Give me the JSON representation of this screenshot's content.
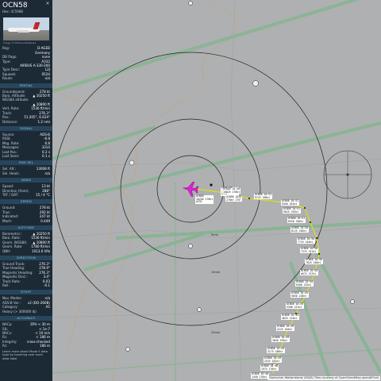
{
  "flight": {
    "callsign": "OCN58",
    "hex_label": "Hex:",
    "hex": "3C5988",
    "photo_credit": "Image © Michael Rodeback"
  },
  "aircraft_info": [
    {
      "k": "Reg:",
      "v": "D-AGEB"
    },
    {
      "k": "",
      "v": "Germany"
    },
    {
      "k": "DB flags:",
      "v": "none"
    },
    {
      "k": "Type:",
      "v": "A332"
    },
    {
      "k": "",
      "v": "AIRBUS A-330-200"
    },
    {
      "k": "Type Desc:",
      "v": "L2J"
    },
    {
      "k": "Squawk:",
      "v": "0524"
    },
    {
      "k": "Route:",
      "v": "n/a"
    }
  ],
  "sections": [
    {
      "title": "SPATIAL",
      "rows": [
        {
          "k": "Groundspeed:",
          "v": "278 kt"
        },
        {
          "k": "Baro. Altitude:",
          "v": "▲ 10250 ft"
        },
        {
          "k": "WGS84 altitude:",
          "v": ""
        },
        {
          "k": "",
          "v": "▲ 10800 ft"
        },
        {
          "k": "Vert. Rate:",
          "v": "1536 ft/min"
        },
        {
          "k": "Track:",
          "v": "276.3°"
        },
        {
          "k": "Pos.:",
          "v": "51.205°, 6.624°"
        },
        {
          "k": "Distance:",
          "v": "1.2 nmi"
        }
      ]
    },
    {
      "title": "SIGNAL",
      "rows": [
        {
          "k": "Source:",
          "v": "ADS-B"
        },
        {
          "k": "RSSI:",
          "v": "-6.8"
        },
        {
          "k": "Msg. Rate:",
          "v": "6.8"
        },
        {
          "k": "Messages:",
          "v": "3314"
        },
        {
          "k": "Last Pos.:",
          "v": "0.2 s"
        },
        {
          "k": "Last Seen:",
          "v": "0.1 s"
        }
      ]
    },
    {
      "title": "FMS SEL",
      "rows": [
        {
          "k": "Sel. Alt.:",
          "v": "13008 ft"
        },
        {
          "k": "Sel. Head.:",
          "v": "n/a"
        }
      ]
    },
    {
      "title": "WIND",
      "rows": [
        {
          "k": "Speed:",
          "v": "13 kt"
        },
        {
          "k": "Direction (from):",
          "v": "288°"
        },
        {
          "k": "TAT / OAT:",
          "v": "15 / 4 °C"
        }
      ]
    },
    {
      "title": "SPEED",
      "rows": [
        {
          "k": "Ground:",
          "v": "278 kt"
        },
        {
          "k": "True:",
          "v": "292 kt"
        },
        {
          "k": "Indicated:",
          "v": "247 kt"
        },
        {
          "k": "Mach:",
          "v": "0.449"
        }
      ]
    },
    {
      "title": "ALTITUDE",
      "rows": [
        {
          "k": "Barometric:",
          "v": "▲ 10250 ft"
        },
        {
          "k": "Baro. Rate:",
          "v": "1536 ft/min"
        },
        {
          "k": "Geom. WGS84:",
          "v": "▲ 10800 ft"
        },
        {
          "k": "Geom. Rate:",
          "v": "1780 ft/min"
        },
        {
          "k": "QNH:",
          "v": "1013.6 hPa"
        }
      ]
    },
    {
      "title": "DIRECTION",
      "rows": [
        {
          "k": "Ground Track:",
          "v": "276.3°"
        },
        {
          "k": "True Heading:",
          "v": "278.9°"
        },
        {
          "k": "Magnetic Heading:",
          "v": "276.3°"
        },
        {
          "k": "Magnetic Decl.:",
          "v": "3.4°"
        },
        {
          "k": "Track Rate:",
          "v": "0.03"
        },
        {
          "k": "Roll:",
          "v": "-0.1"
        }
      ]
    },
    {
      "title": "STUFF",
      "rows": [
        {
          "k": "Nav. Modes:",
          "v": "n/a"
        },
        {
          "k": "ADS-B Ver.:",
          "v": "v2 (DO-260B)"
        },
        {
          "k": "Category:",
          "v": "A5"
        },
        {
          "k": "Heavy (> 300000 lb)",
          "v": ""
        }
      ]
    },
    {
      "title": "ACCURACY",
      "rows": [
        {
          "k": "NACp:",
          "v": "EPU < 30 m"
        },
        {
          "k": "SIL:",
          "v": "< 1e-7"
        },
        {
          "k": "NACv:",
          "v": "< 10 m/s"
        },
        {
          "k": "Rc:",
          "v": "< 186 m"
        },
        {
          "k": "Integrity:",
          "v": "cross-checked"
        },
        {
          "k": "Rc:",
          "v": "186 m"
        }
      ]
    }
  ],
  "footer_text": "Learn more about Mode S data type by hovering over each data label",
  "map": {
    "attribution": "Deutscher Wetterdienst (DWD) Tiles courtesy of OpenStreetMap openAIP.net",
    "aircraft_color": "#e021d8",
    "trail_color": "#d7d92a",
    "range_ring_labels": [
      "5nmi",
      "10nmi",
      "20nmi"
    ],
    "aircraft_label": [
      "OCN58",
      "10250 278kt",
      "A332"
    ],
    "nearby_label": [
      "OCN11ZP",
      "12750 283kt",
      "A332"
    ],
    "trail_labels": [
      {
        "a": "OCN58 1026",
        "b": "278kt 276°"
      },
      {
        "a": "OCN58 10:50",
        "b": "10825 278kt"
      },
      {
        "a": "OCN58 10:51",
        "b": "9725 266kt"
      },
      {
        "a": "OCN58 10:51",
        "b": "9450 261kt"
      },
      {
        "a": "OCN58 10:51",
        "b": "9025 255kt"
      },
      {
        "a": "OCN58 10:51",
        "b": "8550 250kt"
      },
      {
        "a": "OCN58 10:50",
        "b": "8125 246kt"
      },
      {
        "a": "OCN58 10:50",
        "b": "7725 244kt"
      },
      {
        "a": "OCN58 10:50",
        "b": "7375 241kt"
      },
      {
        "a": "OCN58 10:50",
        "b": "7025 240kt"
      },
      {
        "a": "OCN58 10:50",
        "b": "6675 237kt"
      },
      {
        "a": "OCN58 10:50",
        "b": "6300 232kt"
      },
      {
        "a": "OCN58 10:49",
        "b": "5850 228kt"
      },
      {
        "a": "OCN58 10:49",
        "b": "5300 221kt"
      },
      {
        "a": "OCN58 10:49",
        "b": "4825 214kt"
      },
      {
        "a": "OCN58 10:49",
        "b": "4225 204kt"
      },
      {
        "a": "OCN58 10:49",
        "b": "3650 195kt"
      },
      {
        "a": "OCN58 10:49",
        "b": "3175 188kt"
      },
      {
        "a": "OCN58 10:49",
        "b": "2525 181kt"
      },
      {
        "a": "OCN58 10:48",
        "b": "1975 176kt"
      },
      {
        "a": "OCN58 10:48",
        "b": "1450 170kt"
      }
    ]
  }
}
